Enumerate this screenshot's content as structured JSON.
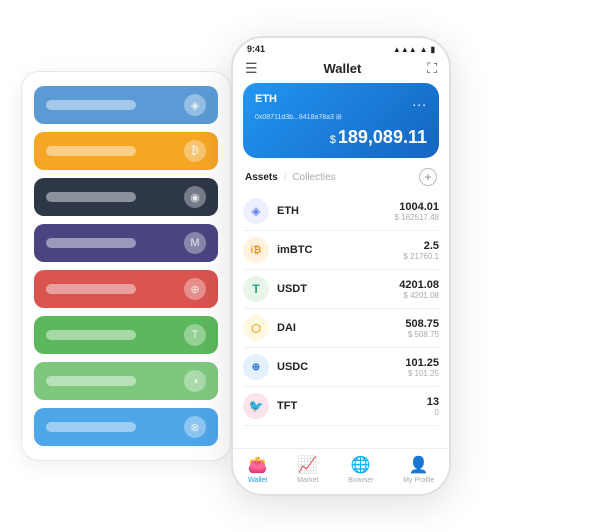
{
  "status_bar": {
    "time": "9:41",
    "signal": "●●●",
    "wifi": "▲",
    "battery": "▮"
  },
  "header": {
    "menu_icon": "☰",
    "title": "Wallet",
    "scan_icon": "⛶"
  },
  "wallet_card": {
    "coin": "ETH",
    "address": "0x08711d3b...8418a78a3 ⊞",
    "dollar_sign": "$",
    "balance": "189,089.11",
    "more": "..."
  },
  "assets": {
    "tab_active": "Assets",
    "tab_divider": "/",
    "tab_inactive": "Collecties",
    "add_icon": "+"
  },
  "asset_list": [
    {
      "icon": "◈",
      "icon_color": "#627eea",
      "icon_bg": "#eef0ff",
      "name": "ETH",
      "amount": "1004.01",
      "usd": "$ 162517.48"
    },
    {
      "icon": "₿",
      "icon_color": "#f7931a",
      "icon_bg": "#fff3e0",
      "name": "imBTC",
      "amount": "2.5",
      "usd": "$ 21760.1"
    },
    {
      "icon": "T",
      "icon_color": "#26a17b",
      "icon_bg": "#e8f5e9",
      "name": "USDT",
      "amount": "4201.08",
      "usd": "$ 4201.08"
    },
    {
      "icon": "◑",
      "icon_color": "#f5a623",
      "icon_bg": "#fff8e1",
      "name": "DAI",
      "amount": "508.75",
      "usd": "$ 508.75"
    },
    {
      "icon": "⊕",
      "icon_color": "#2775ca",
      "icon_bg": "#e3f0ff",
      "name": "USDC",
      "amount": "101.25",
      "usd": "$ 101.25"
    },
    {
      "icon": "🐦",
      "icon_color": "#e91e8c",
      "icon_bg": "#fce4ec",
      "name": "TFT",
      "amount": "13",
      "usd": "0"
    }
  ],
  "nav": [
    {
      "icon": "👛",
      "label": "Wallet",
      "active": true
    },
    {
      "icon": "📈",
      "label": "Market",
      "active": false
    },
    {
      "icon": "🌐",
      "label": "Browser",
      "active": false
    },
    {
      "icon": "👤",
      "label": "My Profile",
      "active": false
    }
  ],
  "card_stack": [
    {
      "color": "#5b9bd5",
      "icon": "◈"
    },
    {
      "color": "#f5a623",
      "icon": "₿"
    },
    {
      "color": "#2d3748",
      "icon": "◉"
    },
    {
      "color": "#4a4580",
      "icon": "M"
    },
    {
      "color": "#d9534f",
      "icon": "⊕"
    },
    {
      "color": "#5cb85c",
      "icon": "T"
    },
    {
      "color": "#7ec87e",
      "icon": "◑"
    },
    {
      "color": "#4da6e8",
      "icon": "⊗"
    }
  ]
}
